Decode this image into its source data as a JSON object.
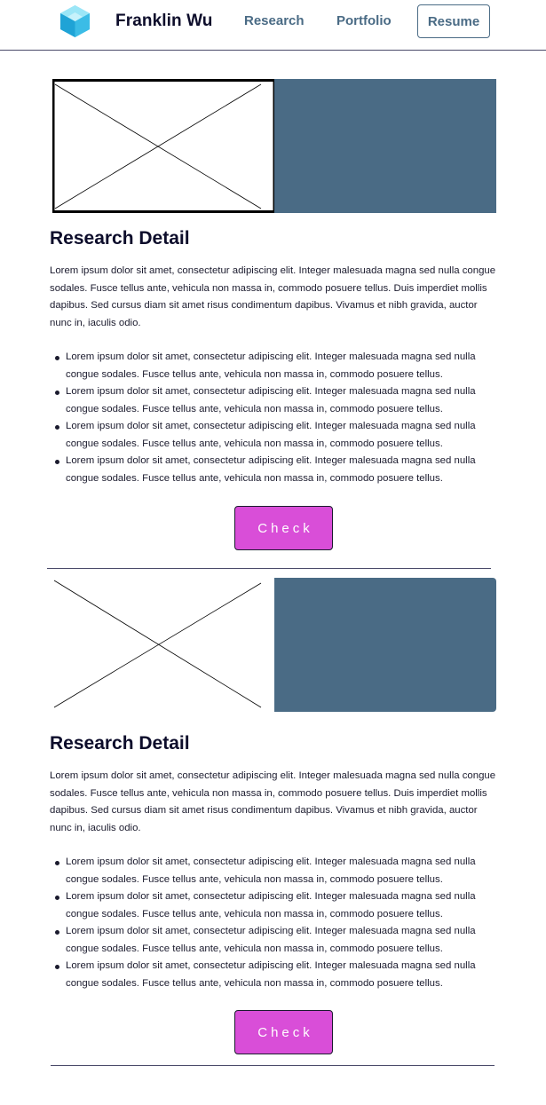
{
  "header": {
    "brand": "Franklin Wu",
    "logo_icon": "hexagon-cube-logo-icon",
    "nav": {
      "research": "Research",
      "portfolio": "Portfolio",
      "resume": "Resume"
    }
  },
  "sections": [
    {
      "image_icon": "image-placeholder-icon",
      "title": "Research Detail",
      "paragraph": "Lorem ipsum dolor sit amet, consectetur adipiscing elit. Integer malesuada magna sed nulla congue sodales. Fusce tellus ante, vehicula non massa in, commodo posuere tellus. Duis imperdiet mollis dapibus. Sed cursus diam sit amet risus condimentum dapibus. Vivamus et nibh gravida, auctor nunc in, iaculis odio.",
      "bullets": [
        "Lorem ipsum dolor sit amet, consectetur adipiscing elit. Integer malesuada magna sed nulla congue sodales. Fusce tellus ante, vehicula non massa in, commodo posuere tellus.",
        "Lorem ipsum dolor sit amet, consectetur adipiscing elit. Integer malesuada magna sed nulla congue sodales. Fusce tellus ante, vehicula non massa in, commodo posuere tellus.",
        "Lorem ipsum dolor sit amet, consectetur adipiscing elit. Integer malesuada magna sed nulla congue sodales. Fusce tellus ante, vehicula non massa in, commodo posuere tellus.",
        "Lorem ipsum dolor sit amet, consectetur adipiscing elit. Integer malesuada magna sed nulla congue sodales. Fusce tellus ante, vehicula non massa in, commodo posuere tellus."
      ],
      "button": "Check"
    },
    {
      "image_icon": "image-placeholder-icon",
      "title": "Research Detail",
      "paragraph": "Lorem ipsum dolor sit amet, consectetur adipiscing elit. Integer malesuada magna sed nulla congue sodales. Fusce tellus ante, vehicula non massa in, commodo posuere tellus. Duis imperdiet mollis dapibus. Sed cursus diam sit amet risus condimentum dapibus. Vivamus et nibh gravida, auctor nunc in, iaculis odio.",
      "bullets": [
        "Lorem ipsum dolor sit amet, consectetur adipiscing elit. Integer malesuada magna sed nulla congue sodales. Fusce tellus ante, vehicula non massa in, commodo posuere tellus.",
        "Lorem ipsum dolor sit amet, consectetur adipiscing elit. Integer malesuada magna sed nulla congue sodales. Fusce tellus ante, vehicula non massa in, commodo posuere tellus.",
        "Lorem ipsum dolor sit amet, consectetur adipiscing elit. Integer malesuada magna sed nulla congue sodales. Fusce tellus ante, vehicula non massa in, commodo posuere tellus.",
        "Lorem ipsum dolor sit amet, consectetur adipiscing elit. Integer malesuada magna sed nulla congue sodales. Fusce tellus ante, vehicula non massa in, commodo posuere tellus."
      ],
      "button": "Check"
    }
  ],
  "colors": {
    "accent_block": "#4a6b85",
    "button": "#d94ed8",
    "nav_link": "#4a6b85",
    "heading": "#0d0d2b"
  }
}
